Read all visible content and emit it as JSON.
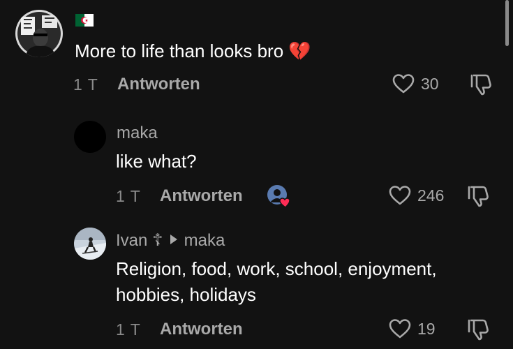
{
  "comments": [
    {
      "username": "",
      "badge": "flag-algeria",
      "text": "More to life than looks bro 💔",
      "time": "1 T",
      "reply_label": "Antworten",
      "likes": "30"
    },
    {
      "username": "maka",
      "text": "like what?",
      "time": "1 T",
      "reply_label": "Antworten",
      "creator_liked": true,
      "likes": "246"
    },
    {
      "username": "Ivan ☦",
      "reply_to": "maka",
      "text_line1": "Religion, food, work, school, enjoyment,",
      "text_line2": "hobbies, holidays",
      "time": "1 T",
      "reply_label": "Antworten",
      "likes": "19"
    }
  ],
  "colors": {
    "background": "#121212",
    "text_primary": "#ffffff",
    "text_secondary": "#a9a9a9",
    "like_red": "#fe2c55"
  }
}
